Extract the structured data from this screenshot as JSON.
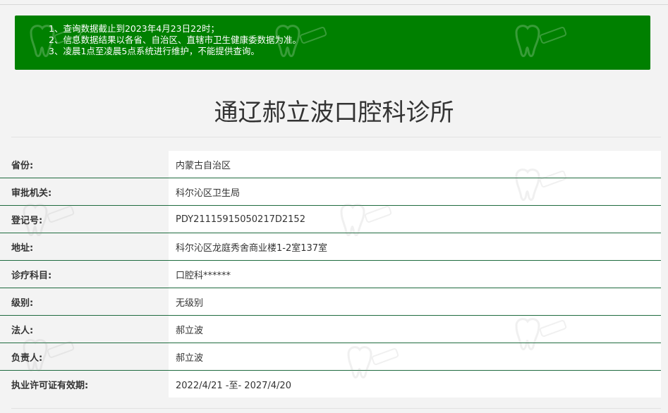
{
  "notice": {
    "lines": [
      "1、查询数据截止到2023年4月23日22时；",
      "2、信息数据结果以各省、自治区、直辖市卫生健康委数据为准。",
      "3、凌晨1点至凌晨5点系统进行维护，不能提供查询。"
    ],
    "background_color": "#008000"
  },
  "clinic_name": "通辽郝立波口腔科诊所",
  "fields": [
    {
      "label": "省份:",
      "value": "内蒙古自治区"
    },
    {
      "label": "审批机关:",
      "value": "科尔沁区卫生局"
    },
    {
      "label": "登记号:",
      "value": "PDY21115915050217D2152"
    },
    {
      "label": "地址:",
      "value": "科尔沁区龙庭秀舍商业楼1-2室137室"
    },
    {
      "label": "诊疗科目:",
      "value": "口腔科******"
    },
    {
      "label": "级别:",
      "value": "无级别"
    },
    {
      "label": "法人:",
      "value": "郝立波"
    },
    {
      "label": "负责人:",
      "value": "郝立波"
    },
    {
      "label": "执业许可证有效期:",
      "value": "2022/4/21 -至- 2027/4/20"
    }
  ],
  "colors": {
    "row_separator": "#1f6b3f",
    "value_background": "#ffffff",
    "page_background": "#f3f3f3"
  },
  "watermark_icon": "tooth-logo-watermark"
}
